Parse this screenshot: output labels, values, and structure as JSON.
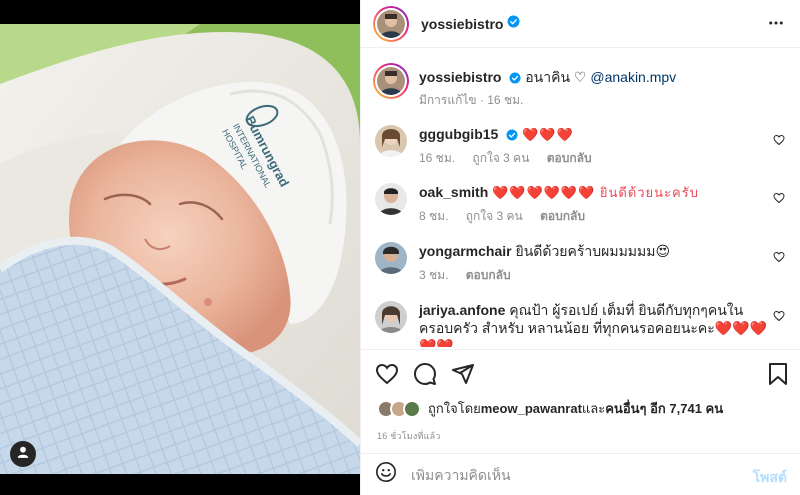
{
  "post": {
    "author": "yossiebistro",
    "media_description": "newborn-baby-photo"
  },
  "header": {
    "username": "yossiebistro",
    "more_icon": "more-horizontal-icon"
  },
  "caption": {
    "username": "yossiebistro",
    "text": "อนาคิน ♡",
    "mention": "@anakin.mpv",
    "edited": "มีการแก้ไข · 16 ชม."
  },
  "comments": [
    {
      "username": "gggubgib15",
      "verified": true,
      "text": "❤️❤️❤️",
      "time": "16 ชม.",
      "likes": "ถูกใจ 3 คน",
      "reply": "ตอบกลับ"
    },
    {
      "username": "oak_smith",
      "verified": false,
      "text": "❤️❤️❤️❤️❤️❤️ ยินดีด้วยนะครับ",
      "time": "8 ชม.",
      "likes": "ถูกใจ 3 คน",
      "reply": "ตอบกลับ"
    },
    {
      "username": "yongarmchair",
      "verified": false,
      "text": "ยินดีด้วยคร้าบผมมมมม😍",
      "time": "3 ชม.",
      "likes": "",
      "reply": "ตอบกลับ"
    },
    {
      "username": "jariya.anfone",
      "verified": false,
      "text": "คุณป้า ผู้รอเปย์ เต็มที่ ยินดีกับทุกๆคนในครอบครัว สำหรับ หลานน้อย ที่ทุกคนรอคอยนะคะ❤️❤️❤️❤️❤️",
      "time": "",
      "likes": "",
      "reply": ""
    }
  ],
  "actions": {
    "like_icon": "heart-icon",
    "comment_icon": "comment-icon",
    "share_icon": "send-icon",
    "save_icon": "bookmark-icon"
  },
  "likes": {
    "prefix": "ถูกใจโดย ",
    "user": "meow_pawanrat",
    "middle": " และ",
    "others": "คนอื่นๆ อีก 7,741 คน"
  },
  "time_ago": "16 ชั่วโมงที่แล้ว",
  "comment_box": {
    "emoji_icon": "smiley-icon",
    "placeholder": "เพิ่มความคิดเห็น",
    "post_label": "โพสต์"
  },
  "colors": {
    "accent_blue": "#0095f6",
    "heart_red": "#ed4956",
    "post_disabled": "#b2dffc"
  }
}
